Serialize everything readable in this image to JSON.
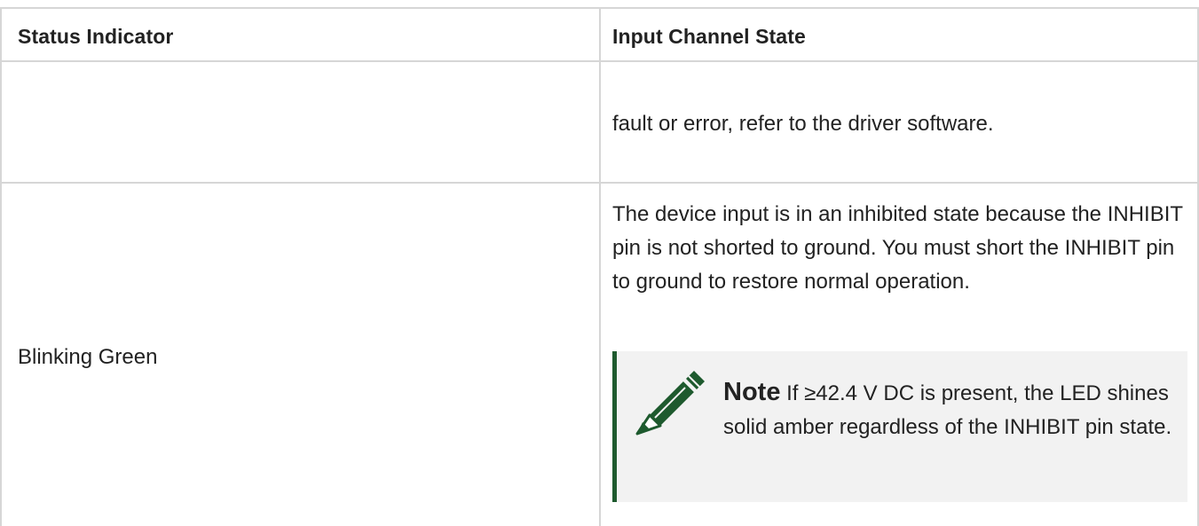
{
  "table": {
    "headers": [
      "Status Indicator",
      "Input Channel State"
    ],
    "rows": [
      {
        "indicator": "",
        "state": "fault or error, refer to the driver software."
      },
      {
        "indicator": "Blinking Green",
        "state": "The device input is in an inhibited state because the INHIBIT pin is not shorted to ground. You must short the INHIBIT pin to ground to restore normal operation.",
        "note": {
          "label": "Note",
          "text": "If ≥42.4 V DC is present, the LED shines solid amber regardless of the INHIBIT pin state.",
          "icon": "pencil-icon"
        }
      }
    ]
  },
  "colors": {
    "grid": "#d6d6d6",
    "note_accent": "#1e5a2e",
    "note_bg": "#f2f2f2",
    "text": "#222222"
  }
}
